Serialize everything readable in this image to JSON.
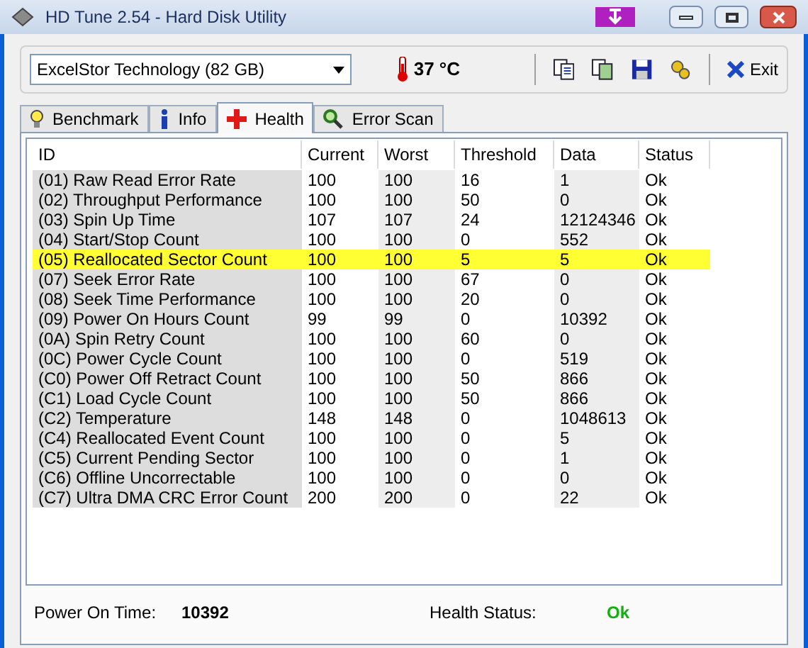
{
  "window": {
    "title": "HD Tune 2.54 - Hard Disk Utility"
  },
  "toolbar": {
    "drive": "ExcelStor Technology (82 GB)",
    "temperature": "37 °C",
    "exit": "Exit"
  },
  "tabs": [
    {
      "label": "Benchmark",
      "selected": false
    },
    {
      "label": "Info",
      "selected": false
    },
    {
      "label": "Health",
      "selected": true
    },
    {
      "label": "Error Scan",
      "selected": false
    }
  ],
  "table": {
    "columns": [
      "ID",
      "Current",
      "Worst",
      "Threshold",
      "Data",
      "Status"
    ],
    "rows": [
      {
        "cells": [
          "(01) Raw Read Error Rate",
          "100",
          "100",
          "16",
          "1",
          "Ok"
        ],
        "selected": false
      },
      {
        "cells": [
          "(02) Throughput Performance",
          "100",
          "100",
          "50",
          "0",
          "Ok"
        ],
        "selected": false
      },
      {
        "cells": [
          "(03) Spin Up Time",
          "107",
          "107",
          "24",
          "12124346",
          "Ok"
        ],
        "selected": false
      },
      {
        "cells": [
          "(04) Start/Stop Count",
          "100",
          "100",
          "0",
          "552",
          "Ok"
        ],
        "selected": false
      },
      {
        "cells": [
          "(05) Reallocated Sector Count",
          "100",
          "100",
          "5",
          "5",
          "Ok"
        ],
        "selected": true
      },
      {
        "cells": [
          "(07) Seek Error Rate",
          "100",
          "100",
          "67",
          "0",
          "Ok"
        ],
        "selected": false
      },
      {
        "cells": [
          "(08) Seek Time Performance",
          "100",
          "100",
          "20",
          "0",
          "Ok"
        ],
        "selected": false
      },
      {
        "cells": [
          "(09) Power On Hours Count",
          "99",
          "99",
          "0",
          "10392",
          "Ok"
        ],
        "selected": false
      },
      {
        "cells": [
          "(0A) Spin Retry Count",
          "100",
          "100",
          "60",
          "0",
          "Ok"
        ],
        "selected": false
      },
      {
        "cells": [
          "(0C) Power Cycle Count",
          "100",
          "100",
          "0",
          "519",
          "Ok"
        ],
        "selected": false
      },
      {
        "cells": [
          "(C0) Power Off Retract Count",
          "100",
          "100",
          "50",
          "866",
          "Ok"
        ],
        "selected": false
      },
      {
        "cells": [
          "(C1) Load Cycle Count",
          "100",
          "100",
          "50",
          "866",
          "Ok"
        ],
        "selected": false
      },
      {
        "cells": [
          "(C2) Temperature",
          "148",
          "148",
          "0",
          "1048613",
          "Ok"
        ],
        "selected": false
      },
      {
        "cells": [
          "(C4) Reallocated Event Count",
          "100",
          "100",
          "0",
          "5",
          "Ok"
        ],
        "selected": false
      },
      {
        "cells": [
          "(C5) Current Pending Sector",
          "100",
          "100",
          "0",
          "1",
          "Ok"
        ],
        "selected": false
      },
      {
        "cells": [
          "(C6) Offline Uncorrectable",
          "100",
          "100",
          "0",
          "0",
          "Ok"
        ],
        "selected": false
      },
      {
        "cells": [
          "(C7) Ultra DMA CRC Error Count",
          "200",
          "200",
          "0",
          "22",
          "Ok"
        ],
        "selected": false
      }
    ]
  },
  "footer": {
    "power_on_label": "Power On Time:",
    "power_on_value": "10392",
    "health_label": "Health Status:",
    "health_value": "Ok"
  }
}
